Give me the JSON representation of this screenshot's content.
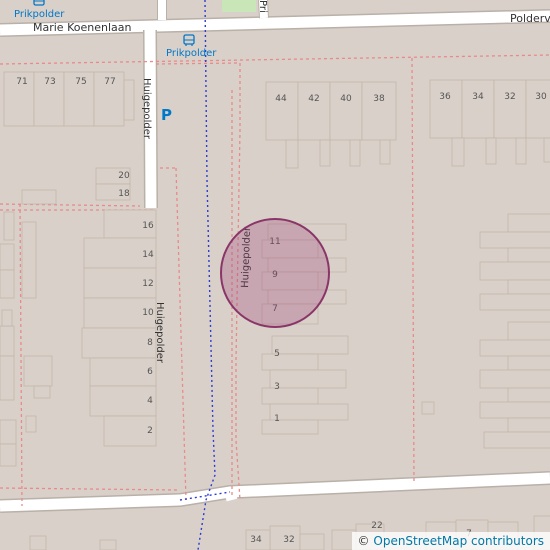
{
  "streets": {
    "marie_koenenlaan": "Marie Koenenlaan",
    "poldervaart": "Polderv",
    "huigepolder_vertical": "Huigepolder",
    "huigepolder_lower": "Huigepolder",
    "huigepolder_diag": "Huigepolder",
    "prikpolder_street": "Pri"
  },
  "pois": {
    "bus_stop_top": "Prikpolder",
    "bus_stop_mid": "Prikpolder",
    "parking": "P"
  },
  "house_numbers": {
    "n71": "71",
    "n73": "73",
    "n75": "75",
    "n77": "77",
    "n44": "44",
    "n42": "42",
    "n40": "40",
    "n38": "38",
    "n36": "36",
    "n34": "34",
    "n32": "32",
    "n30": "30",
    "n20": "20",
    "n18": "18",
    "n16": "16",
    "n14": "14",
    "n12": "12",
    "n10": "10",
    "n8": "8",
    "n6": "6",
    "n4": "4",
    "n2": "2",
    "n11": "11",
    "n9": "9",
    "n7": "7",
    "n5": "5",
    "n3": "3",
    "n1": "1",
    "b34": "34",
    "b32": "32",
    "b7": "7",
    "b22": "22"
  },
  "attribution": {
    "copyright": "©",
    "link_text": "OpenStreetMap contributors"
  },
  "colors": {
    "land": "#d9d0c9",
    "road": "#ffffff",
    "building": "#d9d0c9",
    "boundary": "#e88a8a",
    "path": "#2b3bd6",
    "marker": "#9c3a73",
    "poi": "#0078c8"
  }
}
